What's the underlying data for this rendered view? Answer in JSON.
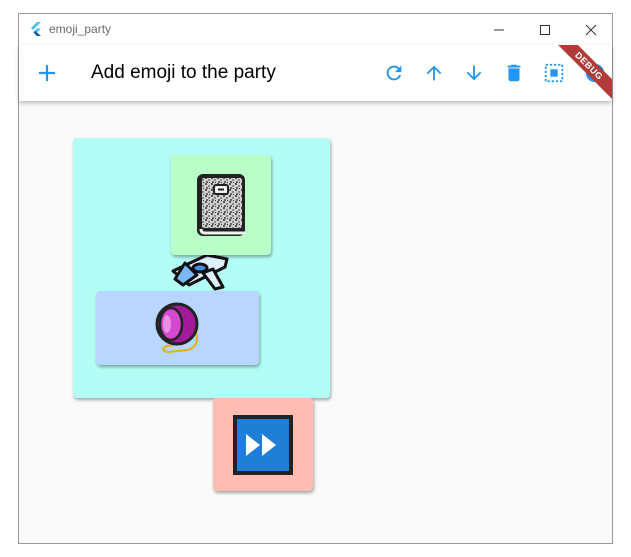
{
  "window": {
    "title": "emoji_party",
    "app_icon": "flutter-logo-icon",
    "controls": [
      "minimize-icon",
      "maximize-icon",
      "close-icon"
    ]
  },
  "appbar": {
    "title": "Add emoji to the party",
    "leading_icon": "add-icon",
    "actions": [
      "refresh-icon",
      "arrow-up-icon",
      "arrow-down-icon",
      "delete-icon",
      "select-all-icon"
    ],
    "accent": "#2196f3"
  },
  "debug_banner": "DEBUG",
  "cards": [
    {
      "name": "cyan-container-card",
      "color": "#b2fef6",
      "emoji": "none"
    },
    {
      "name": "notebook-emoji-card",
      "color": "#b9fdc9",
      "emoji": "notebook-icon"
    },
    {
      "name": "airplane-emoji",
      "emoji": "airplane-icon"
    },
    {
      "name": "yoyo-emoji-card",
      "color": "#b8d6fe",
      "emoji": "yoyo-icon"
    },
    {
      "name": "fast-forward-emoji-card",
      "color": "#ffbcb3",
      "emoji": "fast-forward-icon"
    }
  ]
}
